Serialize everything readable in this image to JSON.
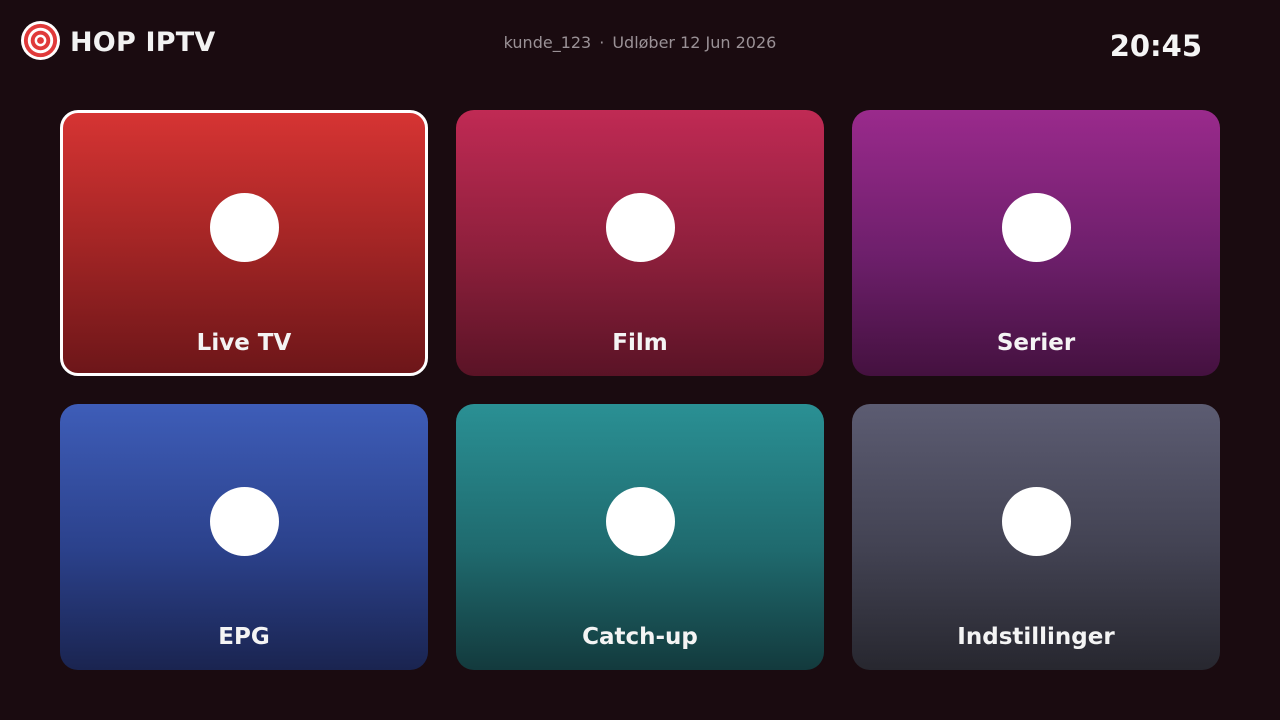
{
  "header": {
    "brand": "HOP IPTV",
    "username": "kunde_123",
    "separator": "·",
    "expiry": "Udløber 12 Jun 2026",
    "clock": "20:45",
    "logo_icon": "target-icon",
    "logo_color": "#e03a3a"
  },
  "tiles": [
    {
      "label": "Live TV",
      "focused": true,
      "color": "#d63433",
      "icon": "circle-icon"
    },
    {
      "label": "Film",
      "focused": false,
      "color": "#c02a54",
      "icon": "circle-icon"
    },
    {
      "label": "Serier",
      "focused": false,
      "color": "#9a2a8c",
      "icon": "circle-icon"
    },
    {
      "label": "EPG",
      "focused": false,
      "color": "#3e5db8",
      "icon": "circle-icon"
    },
    {
      "label": "Catch-up",
      "focused": false,
      "color": "#2a9094",
      "icon": "circle-icon"
    },
    {
      "label": "Indstillinger",
      "focused": false,
      "color": "#5c5c72",
      "icon": "circle-icon"
    }
  ]
}
